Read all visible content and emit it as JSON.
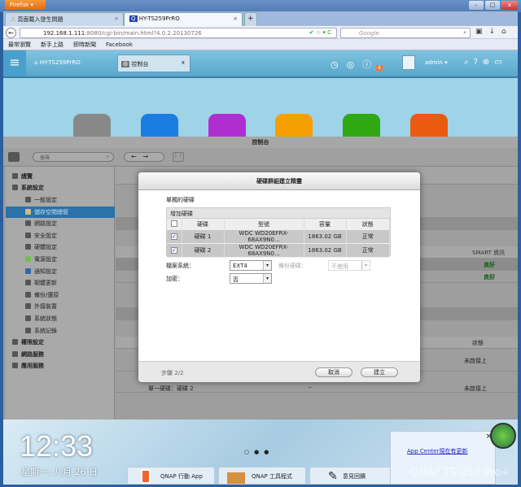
{
  "browser": {
    "menu_label": "Firefox",
    "tabs": [
      {
        "label": "頁面載入發生問題",
        "icon": "warning-icon"
      },
      {
        "label": "HY-TS259PrRO",
        "icon": "qnap-icon"
      }
    ],
    "new_tab": "+",
    "url_host": "192.168.1.111",
    "url_rest": ":8080/cgi-bin/main.html?4.0.2.20130726",
    "search_placeholder": "Google",
    "bookmarks": [
      "最常瀏覽",
      "新手上路",
      "即時新聞",
      "Facebook"
    ]
  },
  "qnap_top": {
    "home_label": "HY-TS259PrRO",
    "tab_label": "控制台",
    "tab_close": "x",
    "notification_count": "4",
    "user": "admin"
  },
  "control_panel": {
    "title": "控制台",
    "search_placeholder": "搜尋",
    "sidebar": [
      {
        "label": "總覽",
        "level": 0
      },
      {
        "label": "系統設定",
        "level": 0
      },
      {
        "label": "一般設定",
        "level": 1
      },
      {
        "label": "儲存空間總管",
        "level": 1,
        "selected": true
      },
      {
        "label": "網路設定",
        "level": 1
      },
      {
        "label": "安全設定",
        "level": 1
      },
      {
        "label": "硬體設定",
        "level": 1
      },
      {
        "label": "電源設定",
        "level": 1
      },
      {
        "label": "通知設定",
        "level": 1
      },
      {
        "label": "韌體更新",
        "level": 1
      },
      {
        "label": "備份/還原",
        "level": 1
      },
      {
        "label": "外接裝置",
        "level": 1
      },
      {
        "label": "系統狀態",
        "level": 1
      },
      {
        "label": "系統記錄",
        "level": 1
      },
      {
        "label": "權限設定",
        "level": 0
      },
      {
        "label": "網路服務",
        "level": 0
      },
      {
        "label": "應用服務",
        "level": 0
      }
    ],
    "background": {
      "smart_header": "SMART 資訊",
      "smart_values": [
        "良好",
        "良好"
      ],
      "status_header": "狀態",
      "status_values": [
        "未啟接上",
        "未啟接上"
      ],
      "single_disk_row": "單一硬碟：硬碟 2",
      "dashes": "--"
    }
  },
  "dialog": {
    "title": "硬碟群組建立精靈",
    "section": "單獨的硬碟",
    "table_title": "增加硬碟",
    "columns": [
      "硬碟",
      "型號",
      "容量",
      "狀態"
    ],
    "rows": [
      {
        "checked": true,
        "disk": "硬碟 1",
        "model": "WDC WD20EFRX-68AX9N0...",
        "capacity": "1863.02 GB",
        "status": "正常"
      },
      {
        "checked": true,
        "disk": "硬碟 2",
        "model": "WDC WD20EFRX-68AX9N0...",
        "capacity": "1863.02 GB",
        "status": "正常"
      }
    ],
    "fs_label": "檔案系統：",
    "fs_value": "EXT4",
    "spare_label": "備份硬碟：",
    "spare_value": "不使用",
    "encrypt_label": "加密：",
    "encrypt_value": "否",
    "step": "步驟 2/2",
    "cancel": "取消",
    "create": "建立"
  },
  "dock": {
    "time": "12:33",
    "date": "星期一, 八月 26 日",
    "buttons": [
      "QNAP 行動 App",
      "QNAP 工具程式",
      "意見回饋"
    ],
    "notification": "App Center現在有更新",
    "notification_close": "×",
    "brand": "QNAP TS-259 Pro+"
  }
}
